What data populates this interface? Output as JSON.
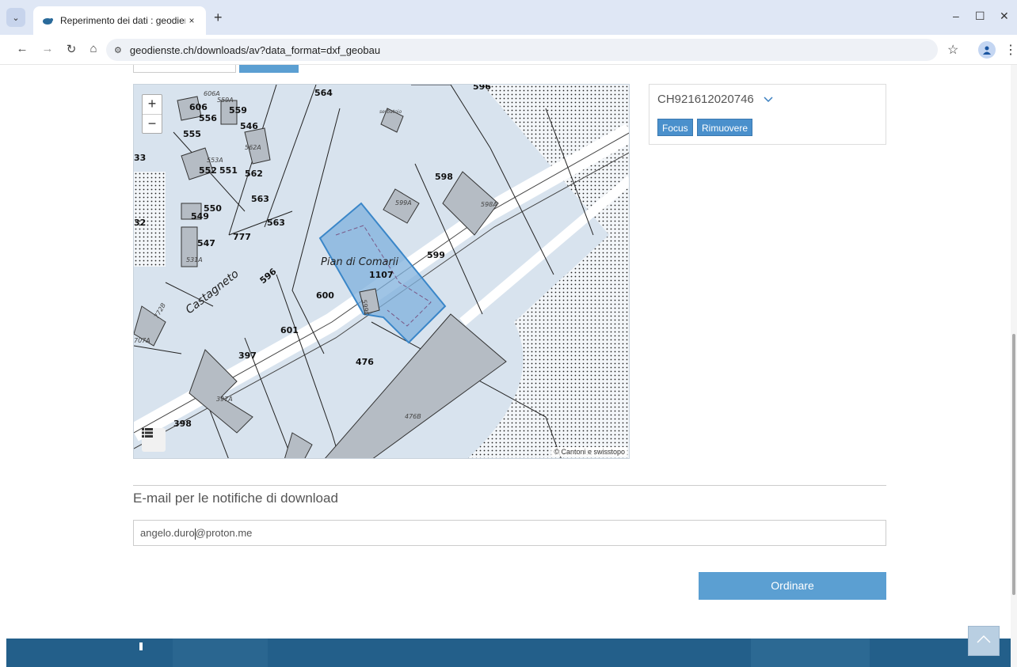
{
  "browser": {
    "tab_title": "Reperimento dei dati : geodienste",
    "url": "geodienste.ch/downloads/av?data_format=dxf_geobau",
    "tab_close": "×",
    "new_tab": "+",
    "win_minimize": "–",
    "win_maximize": "☐",
    "win_close": "✕",
    "tab_menu": "⌄",
    "back": "←",
    "forward": "→",
    "reload": "↻",
    "home": "⌂",
    "site_info": "⚙",
    "bookmark": "☆",
    "more": "⋮"
  },
  "map": {
    "zoom_in": "+",
    "zoom_out": "−",
    "attribution": "© Cantoni e swisstopo",
    "labels": {
      "l564": "564",
      "l596top": "596",
      "l606a": "606A",
      "l559a": "559A",
      "l606": "606",
      "l559": "559",
      "l556": "556",
      "l546": "546",
      "l555": "555",
      "l562a": "562A",
      "l553a": "553A",
      "l552": "552",
      "l551": "551",
      "l562": "562",
      "l33": "33",
      "l563a": "563",
      "l563b": "563",
      "l550": "550",
      "l549": "549",
      "l32": "32",
      "l547": "547",
      "l531a": "531A",
      "l777": "777",
      "l598": "598",
      "l599a": "599A",
      "l598a": "598A",
      "l599": "599",
      "l1107": "1107",
      "l596": "596",
      "l600": "600",
      "l601": "601",
      "l476": "476",
      "l476b": "476B",
      "l397": "397",
      "l397a": "397A",
      "l398": "398",
      "l707a": "707A",
      "l599c": "599C",
      "l772b": "772B",
      "lserb": "serbatoio",
      "castagneto": "Castagneto",
      "pian": "Pian di Comarii"
    }
  },
  "selection": {
    "parcel_id": "CH921612020746",
    "focus_label": "Focus",
    "remove_label": "Rimuovere"
  },
  "email": {
    "label": "E-mail per le notifiche di download",
    "before_caret": "angelo.duro",
    "after_caret": "@proton.me"
  },
  "order_label": "Ordinare",
  "colors": {
    "accent": "#5b9fd2",
    "footer": "#235f8a",
    "highlight": "#4a90cc"
  }
}
